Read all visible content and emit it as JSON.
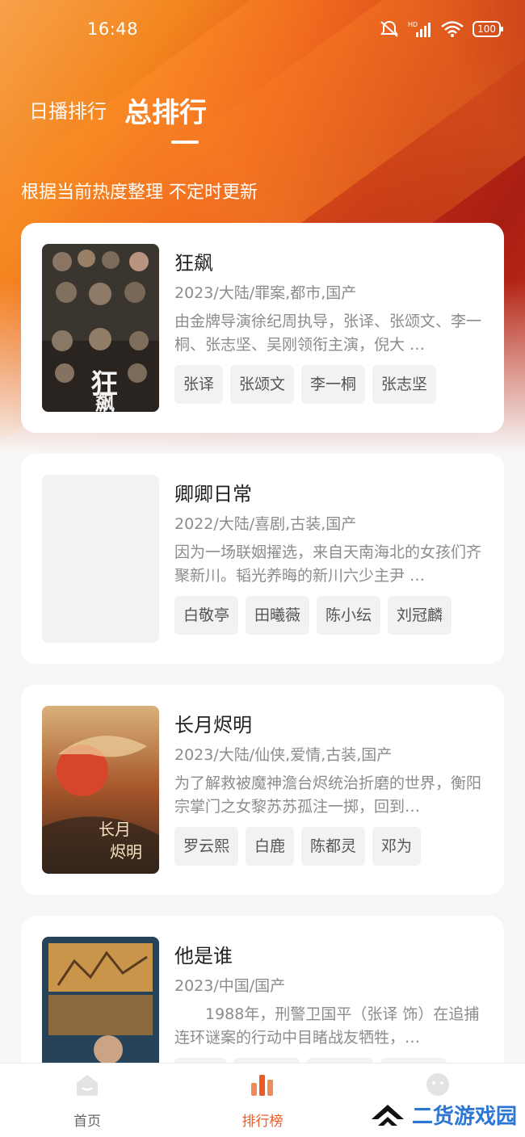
{
  "status_bar": {
    "time": "16:48",
    "battery": "100"
  },
  "tabs": {
    "daily": "日播排行",
    "total": "总排行"
  },
  "subtitle": "根据当前热度整理 不定时更新",
  "items": [
    {
      "title": "狂飙",
      "meta": "2023/大陆/罪案,都市,国产",
      "desc": "由金牌导演徐纪周执导，张译、张颂文、李一桐、张志坚、吴刚领衔主演，倪大 …",
      "tags": [
        "张译",
        "张颂文",
        "李一桐",
        "张志坚"
      ]
    },
    {
      "title": "卿卿日常",
      "meta": "2022/大陆/喜剧,古装,国产",
      "desc": "因为一场联姻擢选，来自天南海北的女孩们齐聚新川。韬光养晦的新川六少主尹 …",
      "tags": [
        "白敬亭",
        "田曦薇",
        "陈小纭",
        "刘冠麟"
      ]
    },
    {
      "title": "长月烬明",
      "meta": "2023/大陆/仙侠,爱情,古装,国产",
      "desc": "为了解救被魔神澹台烬统治折磨的世界，衡阳宗掌门之女黎苏苏孤注一掷，回到…",
      "tags": [
        "罗云熙",
        "白鹿",
        "陈都灵",
        "邓为"
      ]
    },
    {
      "title": "他是谁",
      "meta": "2023/中国/国产",
      "desc": "　　1988年，刑警卫国平（张译 饰）在追捕连环谜案的行动中目睹战友牺牲，…",
      "tags": [
        "",
        "",
        "",
        ""
      ]
    }
  ],
  "nav": {
    "home": "首页",
    "rank": "排行榜",
    "mine": ""
  },
  "watermark": "二货游戏园",
  "colors": {
    "accent": "#ee5a24",
    "hero_start": "#f7a14a",
    "hero_end": "#a81e12"
  }
}
